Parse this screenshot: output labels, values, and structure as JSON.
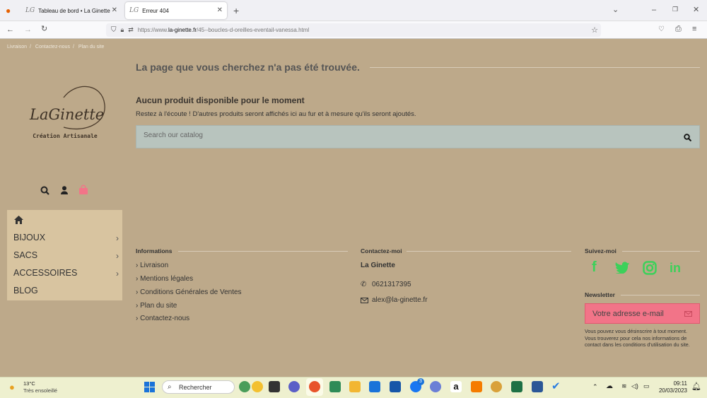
{
  "browser": {
    "tabs": [
      {
        "logo": "LG",
        "title": "Tableau de bord • La Ginette"
      },
      {
        "logo": "LG",
        "title": "Erreur 404"
      }
    ],
    "url_prefix": "https://www.",
    "url_domain": "la-ginette.fr",
    "url_path": "/45--boucles-d-oreilles-eventail-vanessa.html"
  },
  "breadcrumb": [
    "Livraison",
    "Contactez-nous",
    "Plan du site"
  ],
  "logo": {
    "name": "LaGinette",
    "tagline": "Création Artisanale"
  },
  "page": {
    "title": "La page que vous cherchez n'a pas été trouvée.",
    "subtitle": "Aucun produit disponible pour le moment",
    "message": "Restez à l'écoute ! D'autres produits seront affichés ici au fur et à mesure qu'ils seront ajoutés.",
    "search_placeholder": "Search our catalog"
  },
  "menu": {
    "items": [
      {
        "label": "BIJOUX"
      },
      {
        "label": "SACS"
      },
      {
        "label": "ACCESSOIRES"
      },
      {
        "label": "BLOG"
      }
    ]
  },
  "footer": {
    "informations": {
      "title": "Informations",
      "links": [
        "Livraison",
        "Mentions légales",
        "Conditions Générales de Ventes",
        "Plan du site",
        "Contactez-nous"
      ]
    },
    "contact": {
      "title": "Contactez-moi",
      "name": "La Ginette",
      "phone": "0621317395",
      "email": "alex@la-ginette.fr"
    },
    "social": {
      "title": "Suivez-moi",
      "icons": [
        "facebook-icon",
        "twitter-icon",
        "instagram-icon",
        "linkedin-icon"
      ]
    },
    "newsletter": {
      "title": "Newsletter",
      "placeholder": "Votre adresse e-mail",
      "note": "Vous pouvez vous désinscrire à tout moment. Vous trouverez pour cela nos informations de contact dans les conditions d'utilisation du site."
    }
  },
  "taskbar": {
    "weather_temp": "13°C",
    "weather_desc": "Très ensoleillé",
    "search_label": "Rechercher",
    "time": "09:11",
    "date": "20/03/2023",
    "badge": "3"
  },
  "colors": {
    "background": "#bda98a",
    "menu": "#d8c4a0",
    "cart": "#f27488",
    "social": "#3cd15a",
    "search": "#b8c4be"
  }
}
